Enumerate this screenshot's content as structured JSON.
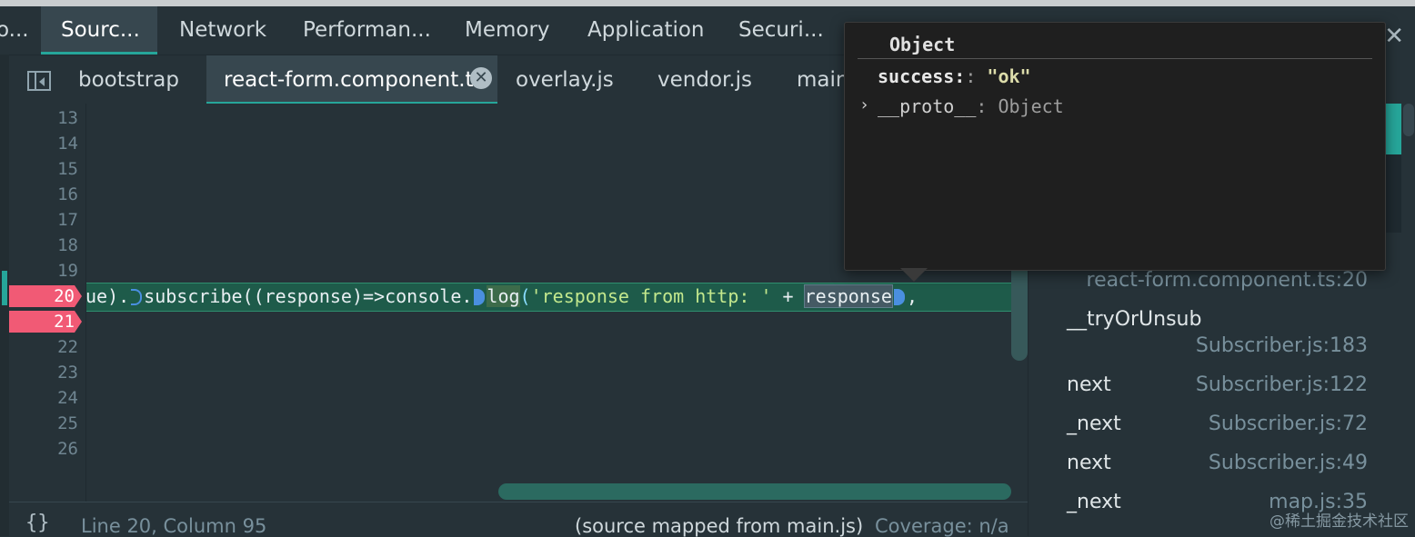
{
  "main_tabs": [
    {
      "label": "o..."
    },
    {
      "label": "Sourc..."
    },
    {
      "label": "Network"
    },
    {
      "label": "Performan..."
    },
    {
      "label": "Memory"
    },
    {
      "label": "Application"
    },
    {
      "label": "Securi..."
    }
  ],
  "close_glyph": "✕",
  "file_tabs": [
    {
      "label": "bootstrap"
    },
    {
      "label": "react-form.component.ts"
    },
    {
      "label": "overlay.js"
    },
    {
      "label": "vendor.js"
    },
    {
      "label": "main"
    }
  ],
  "tab_close_glyph": "✕",
  "editor": {
    "line_numbers": [
      "13",
      "14",
      "15",
      "16",
      "17",
      "18",
      "19",
      "20",
      "21",
      "22",
      "23",
      "24",
      "25",
      "26"
    ],
    "breakpoint_lines": [
      "20",
      "21"
    ],
    "code": {
      "prefix": "ue).",
      "subscribe": "subscribe((response)=>console.",
      "log": "log",
      "open": "(",
      "str": "'response from http: '",
      "plus": " + ",
      "response": "response",
      "tail": ","
    }
  },
  "status": {
    "braces": "{}",
    "position": "Line 20, Column 95",
    "mapped": "(source mapped from main.js)",
    "coverage": "Coverage: n/a"
  },
  "call_stack": [
    {
      "location": "react-form.component.ts:20"
    },
    {
      "function": "__tryOrUnsub",
      "location": "Subscriber.js:183"
    },
    {
      "function": "next",
      "location": "Subscriber.js:122"
    },
    {
      "function": "_next",
      "location": "Subscriber.js:72"
    },
    {
      "function": "next",
      "location": "Subscriber.js:49"
    },
    {
      "function": "_next",
      "location": "map.js:35"
    }
  ],
  "popover": {
    "title": "Object",
    "rows": [
      {
        "key": "success:",
        "colon": ":",
        "value": "\"ok\""
      },
      {
        "key": "__proto__",
        "colon": ":",
        "value": "Object"
      }
    ],
    "chevron": "›"
  },
  "watermark": "@稀土掘金技术社区",
  "colors": {
    "accent": "#26a69a",
    "breakpoint": "#f15a75",
    "background": "#263238"
  }
}
